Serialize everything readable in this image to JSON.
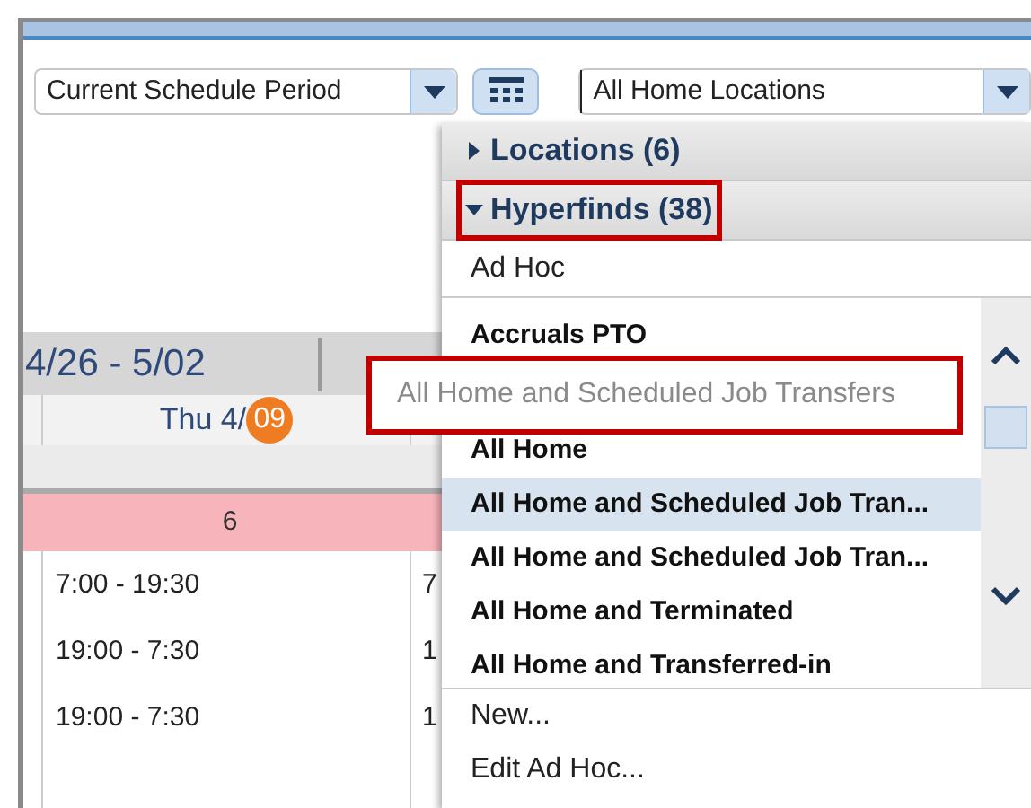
{
  "toolbar": {
    "period_select": {
      "value": "Current Schedule Period"
    },
    "location_select": {
      "value": "All Home Locations"
    }
  },
  "schedule": {
    "period": "4/26 - 5/02",
    "day_header": {
      "label": "Thu 4/",
      "today": "09"
    },
    "count_row": "6",
    "shifts": [
      {
        "column_1": "7:00 - 19:30",
        "column_2": "7"
      },
      {
        "column_1": "19:00 - 7:30",
        "column_2": "1"
      },
      {
        "column_1": "19:00 - 7:30",
        "column_2": "1"
      }
    ]
  },
  "dropdown": {
    "sections": [
      {
        "label": "Locations (6)",
        "expanded": false,
        "highlighted": false
      },
      {
        "label": "Hyperfinds (38)",
        "expanded": true,
        "highlighted": true
      }
    ],
    "ad_hoc": "Ad Hoc",
    "items": [
      {
        "label": "Accruals PTO",
        "selected": false
      },
      {
        "label": "All Home",
        "selected": false
      },
      {
        "label": "All Home and Scheduled Job Tran...",
        "selected": true
      },
      {
        "label": "All Home and Scheduled Job Tran...",
        "selected": false
      },
      {
        "label": "All Home and Terminated",
        "selected": false
      },
      {
        "label": "All Home and Transferred-in",
        "selected": false
      }
    ],
    "actions": [
      "New...",
      "Edit Ad Hoc..."
    ],
    "tooltip": "All Home and Scheduled Job Transfers"
  }
}
